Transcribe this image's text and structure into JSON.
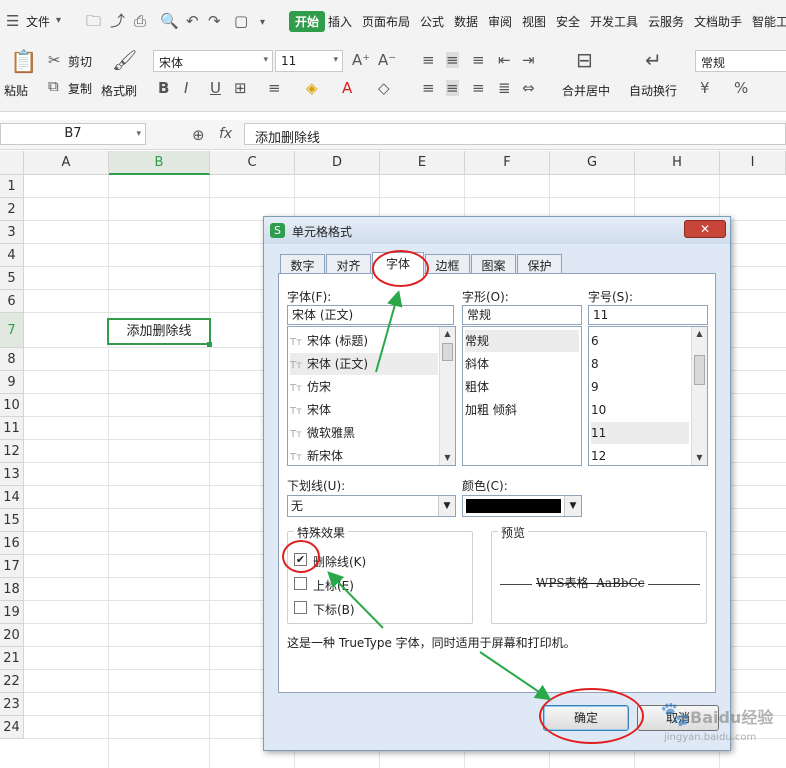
{
  "menubar": {
    "file_label": "文件",
    "tabs": [
      "开始",
      "插入",
      "页面布局",
      "公式",
      "数据",
      "审阅",
      "视图",
      "安全",
      "开发工具",
      "云服务",
      "文档助手",
      "智能工"
    ],
    "active_tab": "开始"
  },
  "ribbon": {
    "paste": "粘贴",
    "cut": "剪切",
    "copy": "复制",
    "format_painter": "格式刷",
    "font_name": "宋体",
    "font_size": "11",
    "merge_center": "合并居中",
    "wrap_text": "自动换行",
    "number_format": "常规",
    "percent": "%"
  },
  "formula_bar": {
    "cell_ref": "B7",
    "fx": "fx",
    "content": "添加删除线"
  },
  "sheet": {
    "columns": [
      "A",
      "B",
      "C",
      "D",
      "E",
      "F",
      "G",
      "H",
      "I"
    ],
    "rows": [
      "1",
      "2",
      "3",
      "4",
      "5",
      "6",
      "7",
      "8",
      "9",
      "10",
      "11",
      "12",
      "13",
      "14",
      "15",
      "16",
      "17",
      "18",
      "19",
      "20",
      "21",
      "22",
      "23",
      "24"
    ],
    "active_cell_text": "添加删除线"
  },
  "dialog": {
    "title": "单元格格式",
    "tabs": [
      "数字",
      "对齐",
      "字体",
      "边框",
      "图案",
      "保护"
    ],
    "active_tab": "字体",
    "font_label": "字体(F):",
    "font_value": "宋体 (正文)",
    "font_list": [
      "宋体 (标题)",
      "宋体 (正文)",
      "仿宋",
      "宋体",
      "微软雅黑",
      "新宋体"
    ],
    "font_selected_index": 1,
    "style_label": "字形(O):",
    "style_value": "常规",
    "style_list": [
      "常规",
      "斜体",
      "粗体",
      "加粗 倾斜"
    ],
    "size_label": "字号(S):",
    "size_value": "11",
    "size_list": [
      "6",
      "8",
      "9",
      "10",
      "11",
      "12"
    ],
    "underline_label": "下划线(U):",
    "underline_value": "无",
    "color_label": "颜色(C):",
    "color_value": "#000000",
    "effects_title": "特殊效果",
    "strikethrough_label": "删除线(K)",
    "superscript_label": "上标(E)",
    "subscript_label": "下标(B)",
    "strikethrough_checked": true,
    "preview_title": "预览",
    "preview_text": "WPS表格  AaBbCc",
    "info_text": "这是一种 TrueType 字体，同时适用于屏幕和打印机。",
    "ok_label": "确定",
    "cancel_label": "取消"
  },
  "watermark": "Baidu经验",
  "watermark_url": "jingyan.baidu.com",
  "colors": {
    "accent_green": "#2f9d4b",
    "annotation_red": "#e02020",
    "arrow_green": "#2aa84a"
  }
}
